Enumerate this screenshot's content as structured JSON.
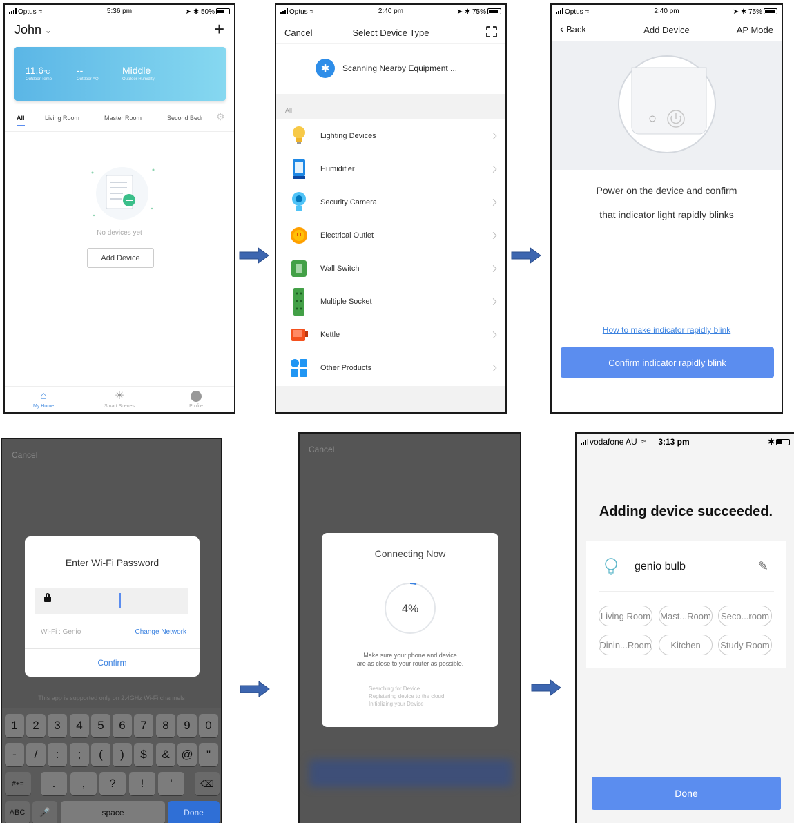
{
  "screen1": {
    "status": {
      "carrier": "Optus",
      "time": "5:36 pm",
      "battery": "50%"
    },
    "home_name": "John",
    "weather": {
      "temp_value": "11.6",
      "temp_unit": "°C",
      "temp_label": "Outdoor Temp",
      "aqi_value": "--",
      "aqi_label": "Outdoor AQI",
      "humidity_value": "Middle",
      "humidity_label": "Outdoor Humidity"
    },
    "tabs": [
      "All",
      "Living Room",
      "Master Room",
      "Second Bedr"
    ],
    "empty_text": "No devices yet",
    "add_device": "Add Device",
    "bottom_nav": [
      "My Home",
      "Smart Scenes",
      "Profile"
    ]
  },
  "screen2": {
    "status": {
      "carrier": "Optus",
      "time": "2:40 pm",
      "battery": "75%"
    },
    "cancel": "Cancel",
    "title": "Select Device Type",
    "scanning": "Scanning Nearby Equipment ...",
    "section": "All",
    "items": [
      {
        "label": "Lighting Devices",
        "icon": "bulb-icon"
      },
      {
        "label": "Humidifier",
        "icon": "humidifier-icon"
      },
      {
        "label": "Security Camera",
        "icon": "camera-icon"
      },
      {
        "label": "Electrical Outlet",
        "icon": "outlet-icon"
      },
      {
        "label": "Wall Switch",
        "icon": "wall-switch-icon"
      },
      {
        "label": "Multiple Socket",
        "icon": "power-strip-icon"
      },
      {
        "label": "Kettle",
        "icon": "kettle-icon"
      },
      {
        "label": "Other Products",
        "icon": "grid-icon"
      }
    ]
  },
  "screen3": {
    "status": {
      "carrier": "Optus",
      "time": "2:40 pm",
      "battery": "75%"
    },
    "back": "Back",
    "title": "Add Device",
    "mode": "AP Mode",
    "instruction_line1": "Power on the device and confirm",
    "instruction_line2": "that indicator light rapidly blinks",
    "help_link": "How to make indicator rapidly blink",
    "confirm_button": "Confirm indicator rapidly blink"
  },
  "screen4": {
    "cancel": "Cancel",
    "dialog_title": "Enter Wi-Fi Password",
    "wifi_label": "Wi-Fi : Genio",
    "change_network": "Change Network",
    "confirm": "Confirm",
    "notice": "This app is supported only on 2.4GHz Wi-Fi channels",
    "keyboard": {
      "row1": [
        "1",
        "2",
        "3",
        "4",
        "5",
        "6",
        "7",
        "8",
        "9",
        "0"
      ],
      "row2": [
        "-",
        "/",
        ":",
        ";",
        "(",
        ")",
        "$",
        "&",
        "@",
        "\""
      ],
      "row3": [
        ".",
        ",",
        "?",
        "!",
        "'"
      ],
      "shift_label": "#+=",
      "abc_label": "ABC",
      "space_label": "space",
      "done_label": "Done"
    }
  },
  "screen5": {
    "cancel": "Cancel",
    "title": "Connecting Now",
    "progress_text": "4%",
    "progress": 0.04,
    "advice_line1": "Make sure your phone and device",
    "advice_line2": "are as close to your router as possible.",
    "steps": [
      "Searching for Device",
      "Registering device to the cloud",
      "Initializing your Device"
    ]
  },
  "screen6": {
    "status": {
      "carrier": "vodafone AU",
      "time": "3:13 pm"
    },
    "heading": "Adding device succeeded.",
    "device_name": "genio bulb",
    "rooms": [
      "Living Room",
      "Mast...Room",
      "Seco...room",
      "Dinin...Room",
      "Kitchen",
      "Study Room"
    ],
    "done": "Done"
  },
  "colors": {
    "accent": "#5b8def",
    "link": "#3b82e0",
    "arrow": "#3d66b0",
    "weather_gradient_start": "#5bb6e6",
    "weather_gradient_end": "#86d8f0"
  }
}
